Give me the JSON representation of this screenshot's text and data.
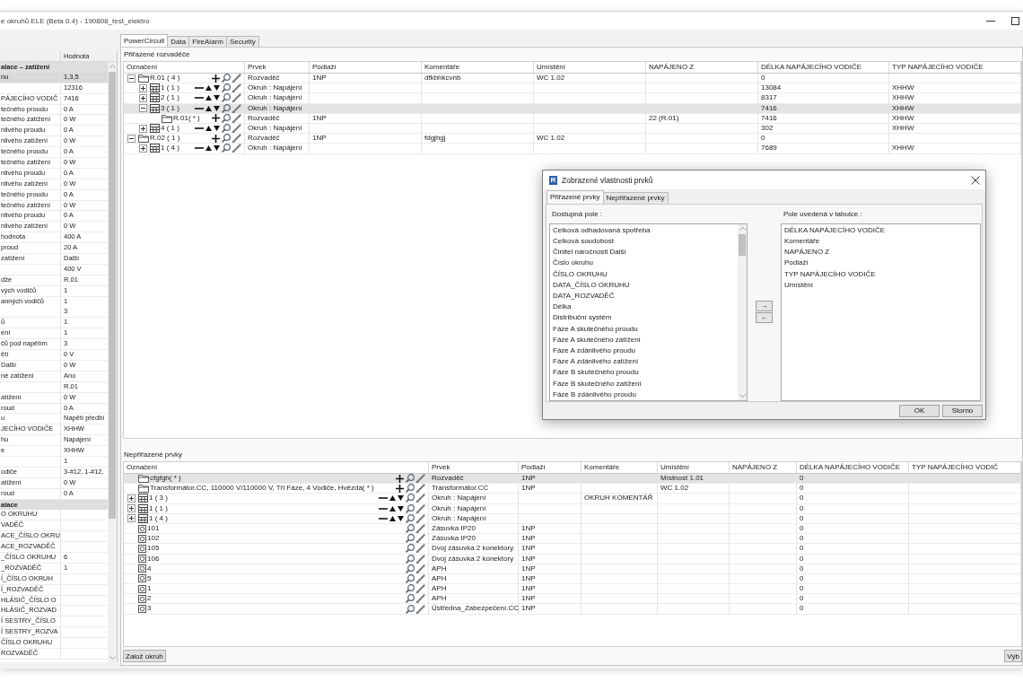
{
  "window": {
    "title": "e okruhů ELE (Beta 0.4) - 190808_test_elektro"
  },
  "properties": {
    "header": "Hodnota",
    "groups": [
      {
        "title": "alace – zatížení",
        "rows": [
          {
            "label": "nu",
            "value": "1,3,5",
            "selected": true
          },
          {
            "value": "12316",
            "selected": false
          },
          {
            "label": "PÁJECÍHO VODIČ",
            "value": "7416",
            "selected": false
          },
          {
            "label": "tečného proudu",
            "value": "0 A",
            "selected": false
          },
          {
            "label": "tečného zatížení",
            "value": "0 W",
            "selected": false
          },
          {
            "label": "nlivého proudu",
            "value": "0 A",
            "selected": false
          },
          {
            "label": "nlivého zatížení",
            "value": "0 W",
            "selected": false
          },
          {
            "label": "tečného proudu",
            "value": "0 A",
            "selected": false
          },
          {
            "label": "tečného zatížení",
            "value": "0 W",
            "selected": false
          },
          {
            "label": "nlivého proudu",
            "value": "0 A",
            "selected": false
          },
          {
            "label": "nlivého zatížení",
            "value": "0 W",
            "selected": false
          },
          {
            "label": "tečného proudu",
            "value": "0 A",
            "selected": false
          },
          {
            "label": "tečného zatížení",
            "value": "0 W",
            "selected": false
          },
          {
            "label": "nlivého proudu",
            "value": "0 A",
            "selected": false
          },
          {
            "label": "nlivého zatížení",
            "value": "0 W",
            "selected": false
          },
          {
            "label": "hodnota",
            "value": "400 A",
            "selected": false
          },
          {
            "label": "proud",
            "value": "20 A",
            "selected": false
          },
          {
            "label": "zatížení",
            "value": "Další",
            "selected": false
          },
          {
            "value": "400 V",
            "selected": false
          },
          {
            "label": "dže",
            "value": "R.01",
            "selected": false
          },
          {
            "label": "vých vodičů",
            "value": "1",
            "selected": false
          },
          {
            "label": "anných vodičů",
            "value": "1",
            "selected": false
          },
          {
            "value": "3",
            "selected": false
          },
          {
            "label": "ů",
            "value": "1",
            "selected": false
          },
          {
            "label": "ení",
            "value": "1",
            "selected": false
          },
          {
            "label": "čů pod napětím",
            "value": "3",
            "selected": false
          },
          {
            "label": "ětí",
            "value": "0 V",
            "selected": false
          },
          {
            "label": "Další",
            "value": "0 W",
            "selected": false
          },
          {
            "label": "né zatížení",
            "value": "Ano",
            "selected": false
          },
          {
            "value": "R.01",
            "selected": false
          },
          {
            "label": "atížení",
            "value": "0 W",
            "selected": false
          },
          {
            "label": "roud",
            "value": "0 A",
            "selected": false
          },
          {
            "label": "u",
            "value": "Napětí předbí",
            "selected": false
          },
          {
            "label": "JECÍHO VODIČE",
            "value": "XHHW",
            "selected": false
          },
          {
            "label": "hu",
            "value": "Napájení",
            "selected": false
          },
          {
            "label": "e",
            "value": "XHHW",
            "selected": false
          },
          {
            "value": "1",
            "selected": false
          },
          {
            "label": "odiče",
            "value": "3-#12, 1-#12,",
            "selected": false
          },
          {
            "label": "atížení",
            "value": "0 W",
            "selected": false
          },
          {
            "label": "roud",
            "value": "0 A",
            "selected": false
          }
        ]
      },
      {
        "title": "alace",
        "rows": [
          {
            "label": "O OKRUHU",
            "selected": false
          },
          {
            "label": "VADĚČ",
            "selected": false
          },
          {
            "label": "ACE_ČÍSLO OKRU",
            "selected": false
          },
          {
            "label": "ACE_ROZVADĚČ",
            "selected": false
          },
          {
            "label": "_ČÍSLO OKRUHU",
            "value": "6",
            "selected": false
          },
          {
            "label": "_ROZVADĚČ",
            "value": "1",
            "selected": false
          },
          {
            "label": "Í_ČÍSLO OKRUH",
            "selected": false
          },
          {
            "label": "Í_ROZVADĚČ",
            "selected": false
          },
          {
            "label": "HLÁSIČ_ČÍSLO O",
            "selected": false
          },
          {
            "label": "HLÁSIČ_ROZVAD",
            "selected": false
          },
          {
            "label": "Í SESTRY_ČÍSLO",
            "selected": false
          },
          {
            "label": "Í SESTRY_ROZVA",
            "selected": false
          },
          {
            "label": "ČÍSLO OKRUHU",
            "selected": false
          },
          {
            "label": "ROZVADĚČ",
            "selected": false
          }
        ]
      }
    ]
  },
  "tabs": [
    {
      "label": "PowerCircuit",
      "selected": true
    },
    {
      "label": "Data",
      "selected": false
    },
    {
      "label": "FireAlarm",
      "selected": false
    },
    {
      "label": "Security",
      "selected": false
    }
  ],
  "assigned": {
    "title": "Přiřazené rozvaděče",
    "columns": [
      "Označení",
      "Prvek",
      "Podlaží",
      "Komentáře",
      "Umístění",
      "NAPÁJENO Z",
      "DÉLKA NAPÁJECÍHO VODIČE",
      "TYP NAPÁJECÍHO VODIČE"
    ],
    "rows": [
      {
        "kind": "panel",
        "label": "R.01 ( 4 )",
        "expanded": true,
        "selected": false,
        "type": "Rozvaděč",
        "floor": "1NP",
        "comment": "dfkbhkcvnb",
        "location": "WC 1.02",
        "length": "0",
        "children": [
          {
            "kind": "circuit",
            "label": "1 ( 1 )",
            "expanded": false,
            "selected": false,
            "type": "Okruh : Napájení",
            "length": "13084",
            "wire": "XHHW"
          },
          {
            "kind": "circuit",
            "label": "2 ( 1 )",
            "expanded": false,
            "selected": false,
            "type": "Okruh : Napájení",
            "length": "8317",
            "wire": "XHHW"
          },
          {
            "kind": "circuit",
            "label": "3 ( 1 )",
            "expanded": true,
            "selected": true,
            "type": "Okruh : Napájení",
            "length": "7416",
            "wire": "XHHW",
            "children": [
              {
                "kind": "panel",
                "label": "R.01( * )",
                "selected": false,
                "type": "Rozvaděč",
                "floor": "1NP",
                "fed_from": "22 (R.01)",
                "length": "7416",
                "wire": "XHHW"
              }
            ]
          },
          {
            "kind": "circuit",
            "label": "4 ( 1 )",
            "expanded": false,
            "selected": false,
            "type": "Okruh : Napájení",
            "length": "302",
            "wire": "XHHW"
          }
        ]
      },
      {
        "kind": "panel",
        "label": "R.02 ( 1 )",
        "expanded": true,
        "selected": false,
        "type": "Rozvaděč",
        "floor": "1NP",
        "comment": "fdgjhgj",
        "location": "WC 1.02",
        "length": "0",
        "children": [
          {
            "kind": "circuit",
            "label": "1 ( 4 )",
            "expanded": false,
            "selected": false,
            "type": "Okruh : Napájení",
            "length": "7689",
            "wire": "XHHW"
          }
        ]
      }
    ]
  },
  "unassigned": {
    "title": "Nepřiřazené prvky",
    "columns": [
      "Označení",
      "Prvek",
      "Podlaží",
      "Komentáře",
      "Umístění",
      "NAPÁJENO Z",
      "DÉLKA NAPÁJECÍHO VODIČE",
      "TYP NAPÁJECÍHO VODIČ"
    ],
    "rows": [
      {
        "kind": "panel",
        "label": "cfgfgh( * )",
        "selected": true,
        "type": "Rozvaděč",
        "floor": "1NP",
        "location": "Místnost 1.01",
        "length": "0"
      },
      {
        "kind": "panel",
        "label": "Transformátor.CC, 110000 V/110000 V, Tři Fáze, 4 Vodiče, Hvězda( * )",
        "selected": false,
        "type": "Transformátor.CC",
        "floor": "1NP",
        "location": "WC 1.02",
        "length": "0"
      },
      {
        "kind": "circuit",
        "label": "1 ( 3 )",
        "expanded": false,
        "selected": false,
        "type": "Okruh : Napájení",
        "comment": "OKRUH KOMENTÁŘ",
        "length": "0"
      },
      {
        "kind": "circuit",
        "label": "1 ( 1 )",
        "expanded": false,
        "selected": false,
        "type": "Okruh : Napájení",
        "length": "0"
      },
      {
        "kind": "circuit",
        "label": "1 ( 4 )",
        "expanded": false,
        "selected": false,
        "type": "Okruh : Napájení",
        "length": "0"
      },
      {
        "kind": "device",
        "label": "101",
        "selected": false,
        "type": "Zásuvka IP20",
        "floor": "1NP",
        "length": "0"
      },
      {
        "kind": "device",
        "label": "102",
        "selected": false,
        "type": "Zásuvka IP20",
        "floor": "1NP",
        "length": "0"
      },
      {
        "kind": "device",
        "label": "105",
        "selected": false,
        "type": "Dvoj zásuvka 2 konektory",
        "floor": "1NP",
        "length": "0"
      },
      {
        "kind": "device",
        "label": "106",
        "selected": false,
        "type": "Dvoj zásuvka 2 konektory",
        "floor": "1NP",
        "length": "0"
      },
      {
        "kind": "device",
        "label": "4",
        "selected": false,
        "type": "APH",
        "floor": "1NP",
        "length": "0"
      },
      {
        "kind": "device",
        "label": "5",
        "selected": false,
        "type": "APH",
        "floor": "1NP",
        "length": "0"
      },
      {
        "kind": "device",
        "label": "1",
        "selected": false,
        "type": "APH",
        "floor": "1NP",
        "length": "0"
      },
      {
        "kind": "device",
        "label": "2",
        "selected": false,
        "type": "APH",
        "floor": "1NP",
        "length": "0"
      },
      {
        "kind": "device",
        "label": "3",
        "selected": false,
        "type": "Ústředna_Zabezpečení.CC",
        "floor": "1NP",
        "length": "0"
      }
    ]
  },
  "create_button": {
    "label": "Založ okruh"
  },
  "select_button": {
    "label": "Výb"
  },
  "dialog": {
    "logo": "R",
    "title": "Zobrazené vlastnosti prvků",
    "tabs": [
      {
        "label": "Přiřazené prvky",
        "selected": true
      },
      {
        "label": "Nepřiřazené prvky",
        "selected": false
      }
    ],
    "available": {
      "label": "Dostupná pole :",
      "items": [
        "Celková odhadovaná spotřeba",
        "Celková soudobost",
        "Činitel náročnosti Další",
        "Číslo okruhu",
        "ČÍSLO OKRUHU",
        "DATA_ČÍSLO OKRUHU",
        "DATA_ROZVADĚČ",
        "Délka",
        "Distribuční systém",
        "Fáze A skutečného proudu",
        "Fáze A skutečného zatížení",
        "Fáze A zdánlivého proudu",
        "Fáze A zdánlivého zatížení",
        "Fáze B skutečného proudu",
        "Fáze B skutečného zatížení",
        "Fáze B zdánlivého proudu"
      ]
    },
    "shown": {
      "label": "Pole uvedená v tabulce :",
      "items": [
        "DÉLKA NAPÁJECÍHO VODIČE",
        "Komentáře",
        "NAPÁJENO Z",
        "Podlaží",
        "TYP NAPÁJECÍHO VODIČE",
        "Umístění"
      ]
    },
    "add_button": "→",
    "remove_button": "←",
    "ok_button": "OK",
    "cancel_button": "Storno"
  }
}
